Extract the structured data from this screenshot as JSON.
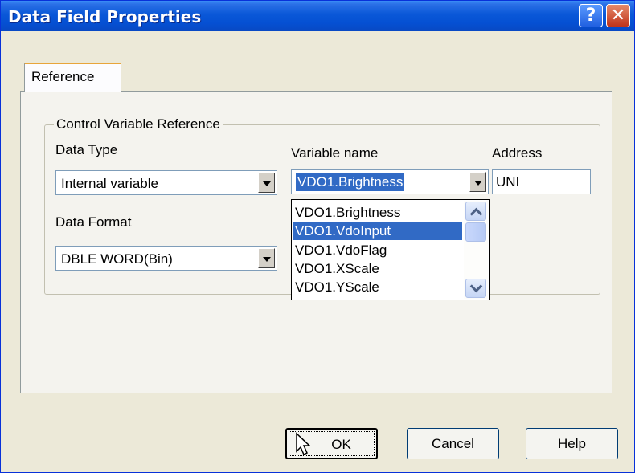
{
  "window": {
    "title": "Data Field Properties",
    "help_label": "?",
    "close_label": "✕"
  },
  "tabs": [
    {
      "label": "Reference",
      "active": true
    }
  ],
  "group": {
    "title": "Control Variable Reference"
  },
  "data_type": {
    "label": "Data Type",
    "value": "Internal variable"
  },
  "data_format": {
    "label": "Data Format",
    "value": "DBLE WORD(Bin)"
  },
  "variable_name": {
    "label": "Variable name",
    "value": "VDO1.Brightness",
    "options": [
      "VDO1.Brightness",
      "VDO1.VdoInput",
      "VDO1.VdoFlag",
      "VDO1.XScale",
      "VDO1.YScale"
    ],
    "highlighted": "VDO1.VdoInput"
  },
  "address": {
    "label": "Address",
    "value": "UNI"
  },
  "buttons": {
    "ok": "OK",
    "cancel": "Cancel",
    "help": "Help"
  }
}
